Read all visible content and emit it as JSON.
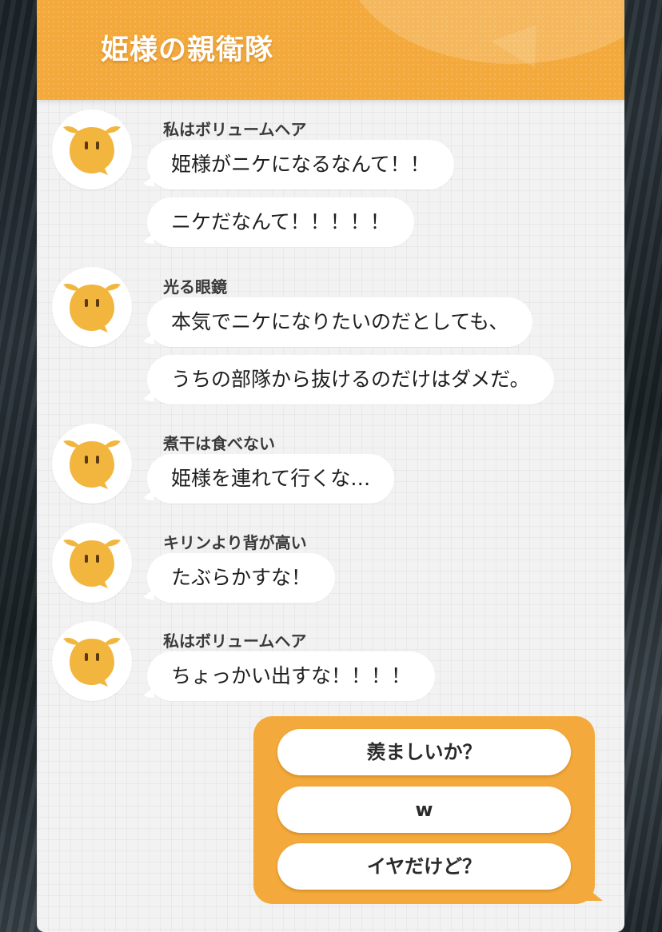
{
  "header": {
    "title": "姫様の親衛隊"
  },
  "messages": [
    {
      "name": "私はボリュームヘア",
      "bubbles": [
        "姫様がニケになるなんて！！",
        "ニケだなんて！！！！！"
      ]
    },
    {
      "name": "光る眼鏡",
      "bubbles": [
        "本気でニケになりたいのだとしても、",
        "うちの部隊から抜けるのだけはダメだ。"
      ]
    },
    {
      "name": "煮干は食べない",
      "bubbles": [
        "姫様を連れて行くな…"
      ]
    },
    {
      "name": "キリンより背が高い",
      "bubbles": [
        "たぶらかすな！"
      ]
    },
    {
      "name": "私はボリュームヘア",
      "bubbles": [
        "ちょっかい出すな！！！！"
      ]
    }
  ],
  "choices": [
    "羨ましいか？",
    "w",
    "イヤだけど？"
  ],
  "colors": {
    "accent": "#f3a93b",
    "avatar_face": "#f2b63e",
    "panel": "#f2f2f2"
  },
  "icons": {
    "avatar": "chick-avatar-icon"
  }
}
